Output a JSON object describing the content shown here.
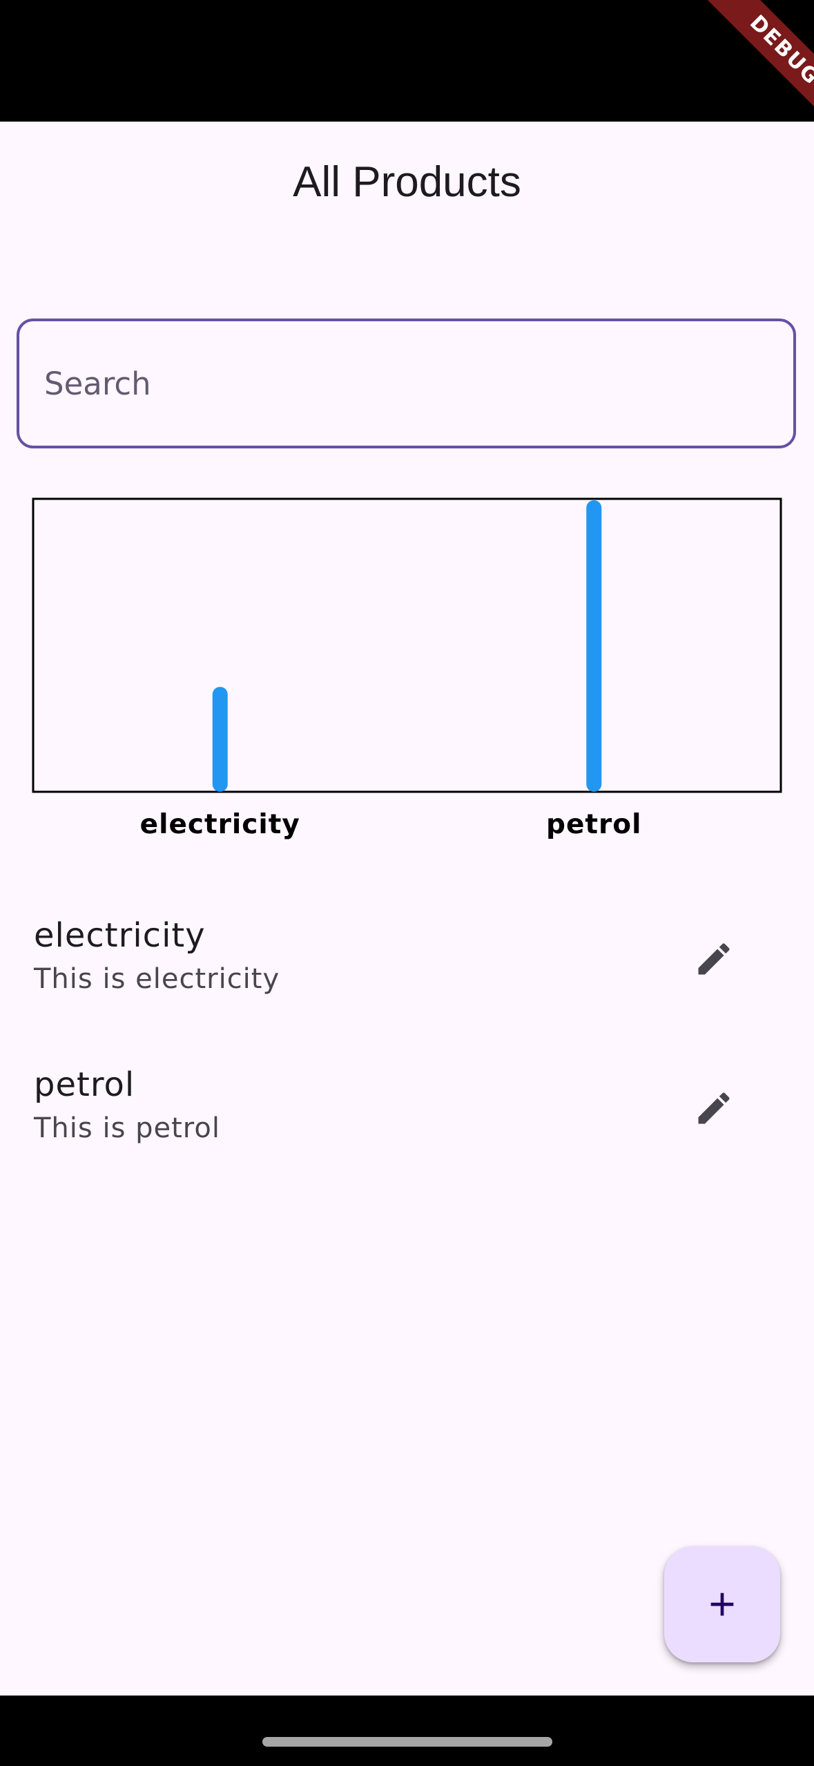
{
  "status_bar": {
    "debug_label": "DEBUG"
  },
  "app_bar": {
    "title": "All Products"
  },
  "search": {
    "placeholder": "Search",
    "value": ""
  },
  "chart_data": {
    "type": "bar",
    "categories": [
      "electricity",
      "petrol"
    ],
    "values": [
      0.36,
      1.0
    ],
    "ylim": [
      0,
      1
    ],
    "grid": false,
    "bar_color": "#2196f3",
    "border_color": "#000000"
  },
  "products": [
    {
      "title": "electricity",
      "subtitle": "This is electricity",
      "action_icon": "pencil-icon"
    },
    {
      "title": "petrol",
      "subtitle": "This is petrol",
      "action_icon": "pencil-icon"
    }
  ],
  "fab": {
    "icon": "plus-icon",
    "color": "#eaddff"
  },
  "colors": {
    "background": "#fef7ff",
    "primary": "#6750a4",
    "on_surface": "#1d1b20",
    "on_surface_variant": "#49454f"
  }
}
